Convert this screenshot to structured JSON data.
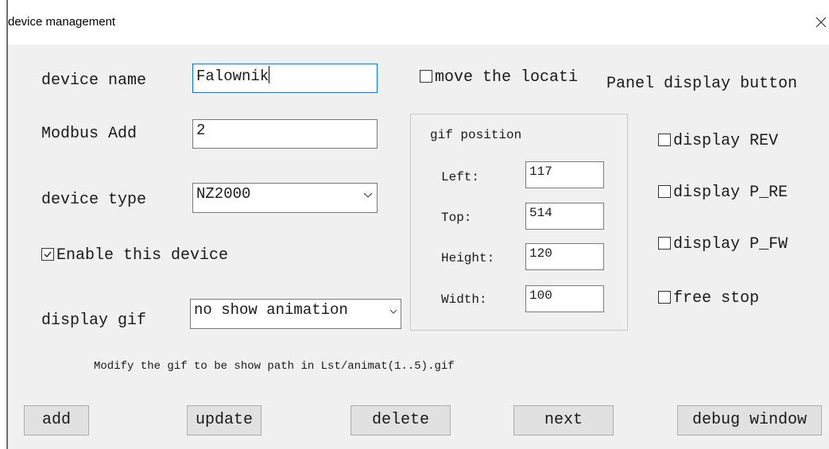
{
  "window": {
    "title": "device management",
    "close_glyph": "×"
  },
  "form": {
    "device_name_label": "device name",
    "device_name_value": "Falownik",
    "modbus_label": "Modbus Add",
    "modbus_value": "2",
    "device_type_label": "device type",
    "device_type_value": "NZ2000",
    "enable_label": "Enable this device",
    "enable_checked": true,
    "display_gif_label": "display gif",
    "display_gif_value": "no show animation",
    "move_location_label": "move the locati",
    "move_location_checked": false,
    "panel_display_label": "Panel display button",
    "hint": "Modify the gif to be show path in  Lst/animat(1..5).gif"
  },
  "gif_position": {
    "title": "gif position",
    "left_label": "Left:",
    "left_value": "117",
    "top_label": "Top:",
    "top_value": "514",
    "height_label": "Height:",
    "height_value": "120",
    "width_label": "Width:",
    "width_value": "100"
  },
  "panel_buttons": {
    "display_rev": "display REV",
    "display_p_re": "display P_RE",
    "display_p_fw": "display P_FW",
    "free_stop": "free stop"
  },
  "buttons": {
    "add": "add",
    "update": "update",
    "delete": "delete",
    "next": "next",
    "debug": "debug window"
  },
  "icons": {
    "close": "close-icon",
    "dropdown": "chevron-down-icon",
    "checkmark": "checkmark-icon"
  }
}
